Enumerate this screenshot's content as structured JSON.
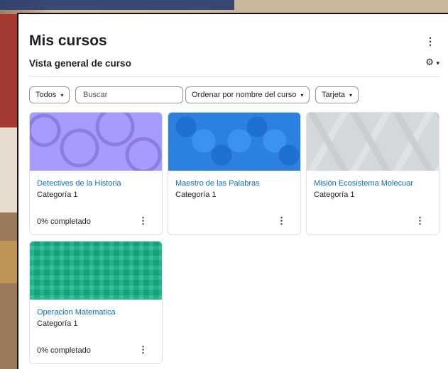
{
  "page": {
    "title": "Mis cursos",
    "subtitle": "Vista general de curso"
  },
  "filters": {
    "grouping": "Todos",
    "search_placeholder": "Buscar",
    "sort": "Ordenar por nombre del curso",
    "view": "Tarjeta"
  },
  "courses": [
    {
      "name": "Detectives de la Historia",
      "category": "Categoría 1",
      "progress": "0% completado",
      "image": "purple-circles"
    },
    {
      "name": "Maestro de las Palabras",
      "category": "Categoría 1",
      "progress": "",
      "image": "blue-octagons"
    },
    {
      "name": "Misión Ecosistema Molecuar",
      "category": "Categoría 1",
      "progress": "",
      "image": "gray-triangles"
    },
    {
      "name": "Operacion Matematica",
      "category": "Categoría 1",
      "progress": "0% completado",
      "image": "green-plaid"
    }
  ],
  "icons": {
    "kebab": "⋮",
    "gear": "⚙",
    "chevron": "⌄"
  }
}
